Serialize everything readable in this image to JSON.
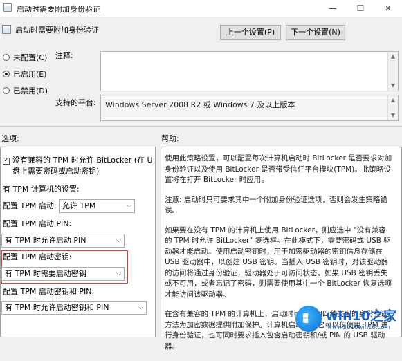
{
  "window": {
    "title": "启动时需要附加身份验证",
    "minimize": "—",
    "maximize": "☐",
    "close": "✕"
  },
  "header": {
    "setting_title": "启动时需要附加身份验证",
    "prev_button": "上一个设置(P)",
    "next_button": "下一个设置(N)"
  },
  "state": {
    "options": [
      {
        "label": "未配置(C)",
        "selected": false
      },
      {
        "label": "已启用(E)",
        "selected": true
      },
      {
        "label": "已禁用(D)",
        "selected": false
      }
    ]
  },
  "comment": {
    "label": "注释:",
    "value": ""
  },
  "platform": {
    "label": "支持的平台:",
    "value": "Windows Server 2008 R2 或 Windows 7 及以上版本"
  },
  "options_section": {
    "label": "选项:",
    "allow_without_tpm_line1": "没有兼容的 TPM 时允许 BitLocker (在 U",
    "allow_without_tpm_line2": "盘上需要密码或启动密钥)",
    "tpm_settings_heading": "有 TPM 计算机的设置:",
    "configure_tpm_startup_label": "配置 TPM 启动:",
    "configure_tpm_startup_value": "允许 TPM",
    "configure_tpm_pin_label": "配置 TPM 启动 PIN:",
    "configure_tpm_pin_value": "有 TPM 时允许启动 PIN",
    "configure_tpm_key_label": "配置 TPM 启动密钥:",
    "configure_tpm_key_value": "有 TPM 时需要启动密钥",
    "configure_tpm_key_pin_label": "配置 TPM 启动密钥和 PIN:",
    "configure_tpm_key_pin_value": "有 TPM 时允许启动密钥和 PIN"
  },
  "help_section": {
    "label": "帮助:",
    "p1": "使用此策略设置，可以配置每次计算机启动时 BitLocker 是否要求对加身份验证以及使用 BitLocker 是否带受信任平台模块(TPM)。此策略设置将在打开 BitLocker 时应用。",
    "p2": "注意: 启动时只可要求其中一个附加身份验证选项，否则会发生策略错误。",
    "p3": "如果要在没有 TPM 的计算机上使用 BitLocker，则应选中 \"没有兼容的 TPM 时允许 BitLocker\" 复选框。在此模式下，需要密码或 USB 驱动器才能启动。使用启动密钥时，用于加密驱动器的密钥信息存储在 USB 驱动器中，以创建 USB 密钥。当插入 USB 密钥时，对该驱动器的访问将通过身份验证，驱动器处于可访问状态。如果 USB 密钥丢失或不可用，或者忘记了密码，则需要使用其中一个 BitLocker 恢复选项才能访问该驱动器。",
    "p4": "在含有兼容的 TPM 的计算机上，启动时可以使用四种类型的身份验证方法为加密数据提供附加保护。计算机启动时，它可以仅使用 TPM 进行身份验证，也可同时要求插入包含启动密钥和/或 PIN 的 USB 驱动器。"
  },
  "watermark": {
    "brand": "win10之家",
    "url": "www.2016win10.com"
  }
}
